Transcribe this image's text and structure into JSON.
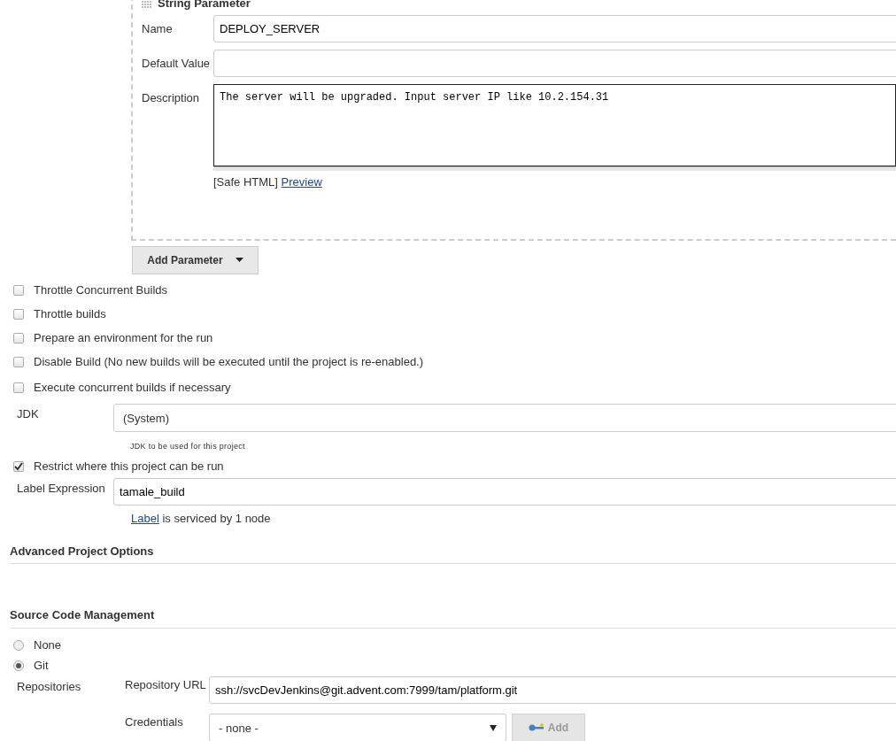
{
  "parameter": {
    "title": "String Parameter",
    "fields": [
      {
        "label": "Name",
        "kind": "text",
        "value": "DEPLOY_SERVER"
      },
      {
        "label": "Default Value",
        "kind": "text"
      },
      {
        "label": "Description",
        "kind": "textarea",
        "value": "The server will be upgraded. Input server IP like 10.2.154.31",
        "note": "[Safe HTML]",
        "link": "Preview"
      }
    ]
  },
  "add_parameter": {
    "label": "Add Parameter"
  },
  "options": [
    {
      "label": "Throttle Concurrent Builds",
      "checked": false
    },
    {
      "label": "Throttle builds",
      "checked": false
    },
    {
      "label": "Prepare an environment for the run",
      "checked": false
    },
    {
      "label": "Disable Build (No new builds will be executed until the project is re-enabled.)",
      "checked": false
    },
    {
      "label": "Execute concurrent builds if necessary",
      "checked": false
    }
  ],
  "jdk": {
    "label": "JDK",
    "value": "(System)",
    "hint": "JDK to be used for this project"
  },
  "restrict": {
    "label": "Restrict where this project can be run",
    "checked": true
  },
  "label_expression": {
    "label": "Label Expression",
    "value": "tamale_build",
    "link": "Label",
    "note": "is serviced by 1 node"
  },
  "sections": [
    "Advanced Project Options",
    "Source Code Management"
  ],
  "scm": [
    {
      "label": "None",
      "selected": false
    },
    {
      "label": "Git",
      "selected": true
    }
  ],
  "repositories": {
    "label": "Repositories",
    "url_label": "Repository URL",
    "url": "ssh://svcDevJenkins@git.advent.com:7999/tam/platform.git",
    "credentials_label": "Credentials",
    "credentials": "- none -",
    "add": {
      "label": "Add",
      "disabled": true
    }
  }
}
